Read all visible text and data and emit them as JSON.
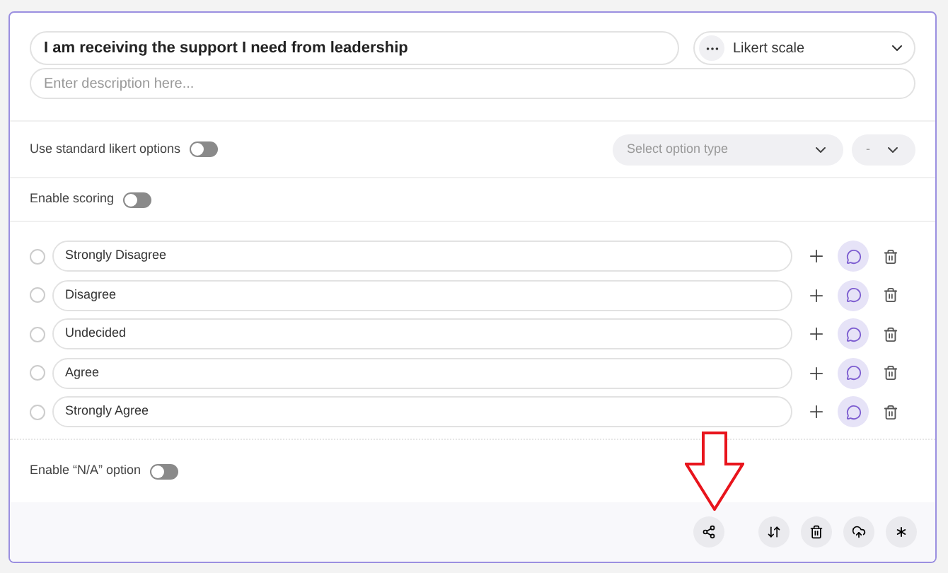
{
  "question": {
    "title": "I am receiving the support I need from leadership",
    "type": "Likert scale",
    "description_placeholder": "Enter description here..."
  },
  "standard_options": {
    "label": "Use standard likert options",
    "on": false,
    "option_type_placeholder": "Select option type",
    "count": "-"
  },
  "scoring": {
    "label": "Enable scoring",
    "on": false
  },
  "options": [
    {
      "label": "Strongly Disagree",
      "selected": false
    },
    {
      "label": "Disagree",
      "selected": false
    },
    {
      "label": "Undecided",
      "selected": false
    },
    {
      "label": "Agree",
      "selected": false
    },
    {
      "label": "Strongly Agree",
      "selected": false
    }
  ],
  "na_option": {
    "label": "Enable “N/A” option",
    "on": false
  },
  "annotation": {
    "kind": "arrow"
  }
}
